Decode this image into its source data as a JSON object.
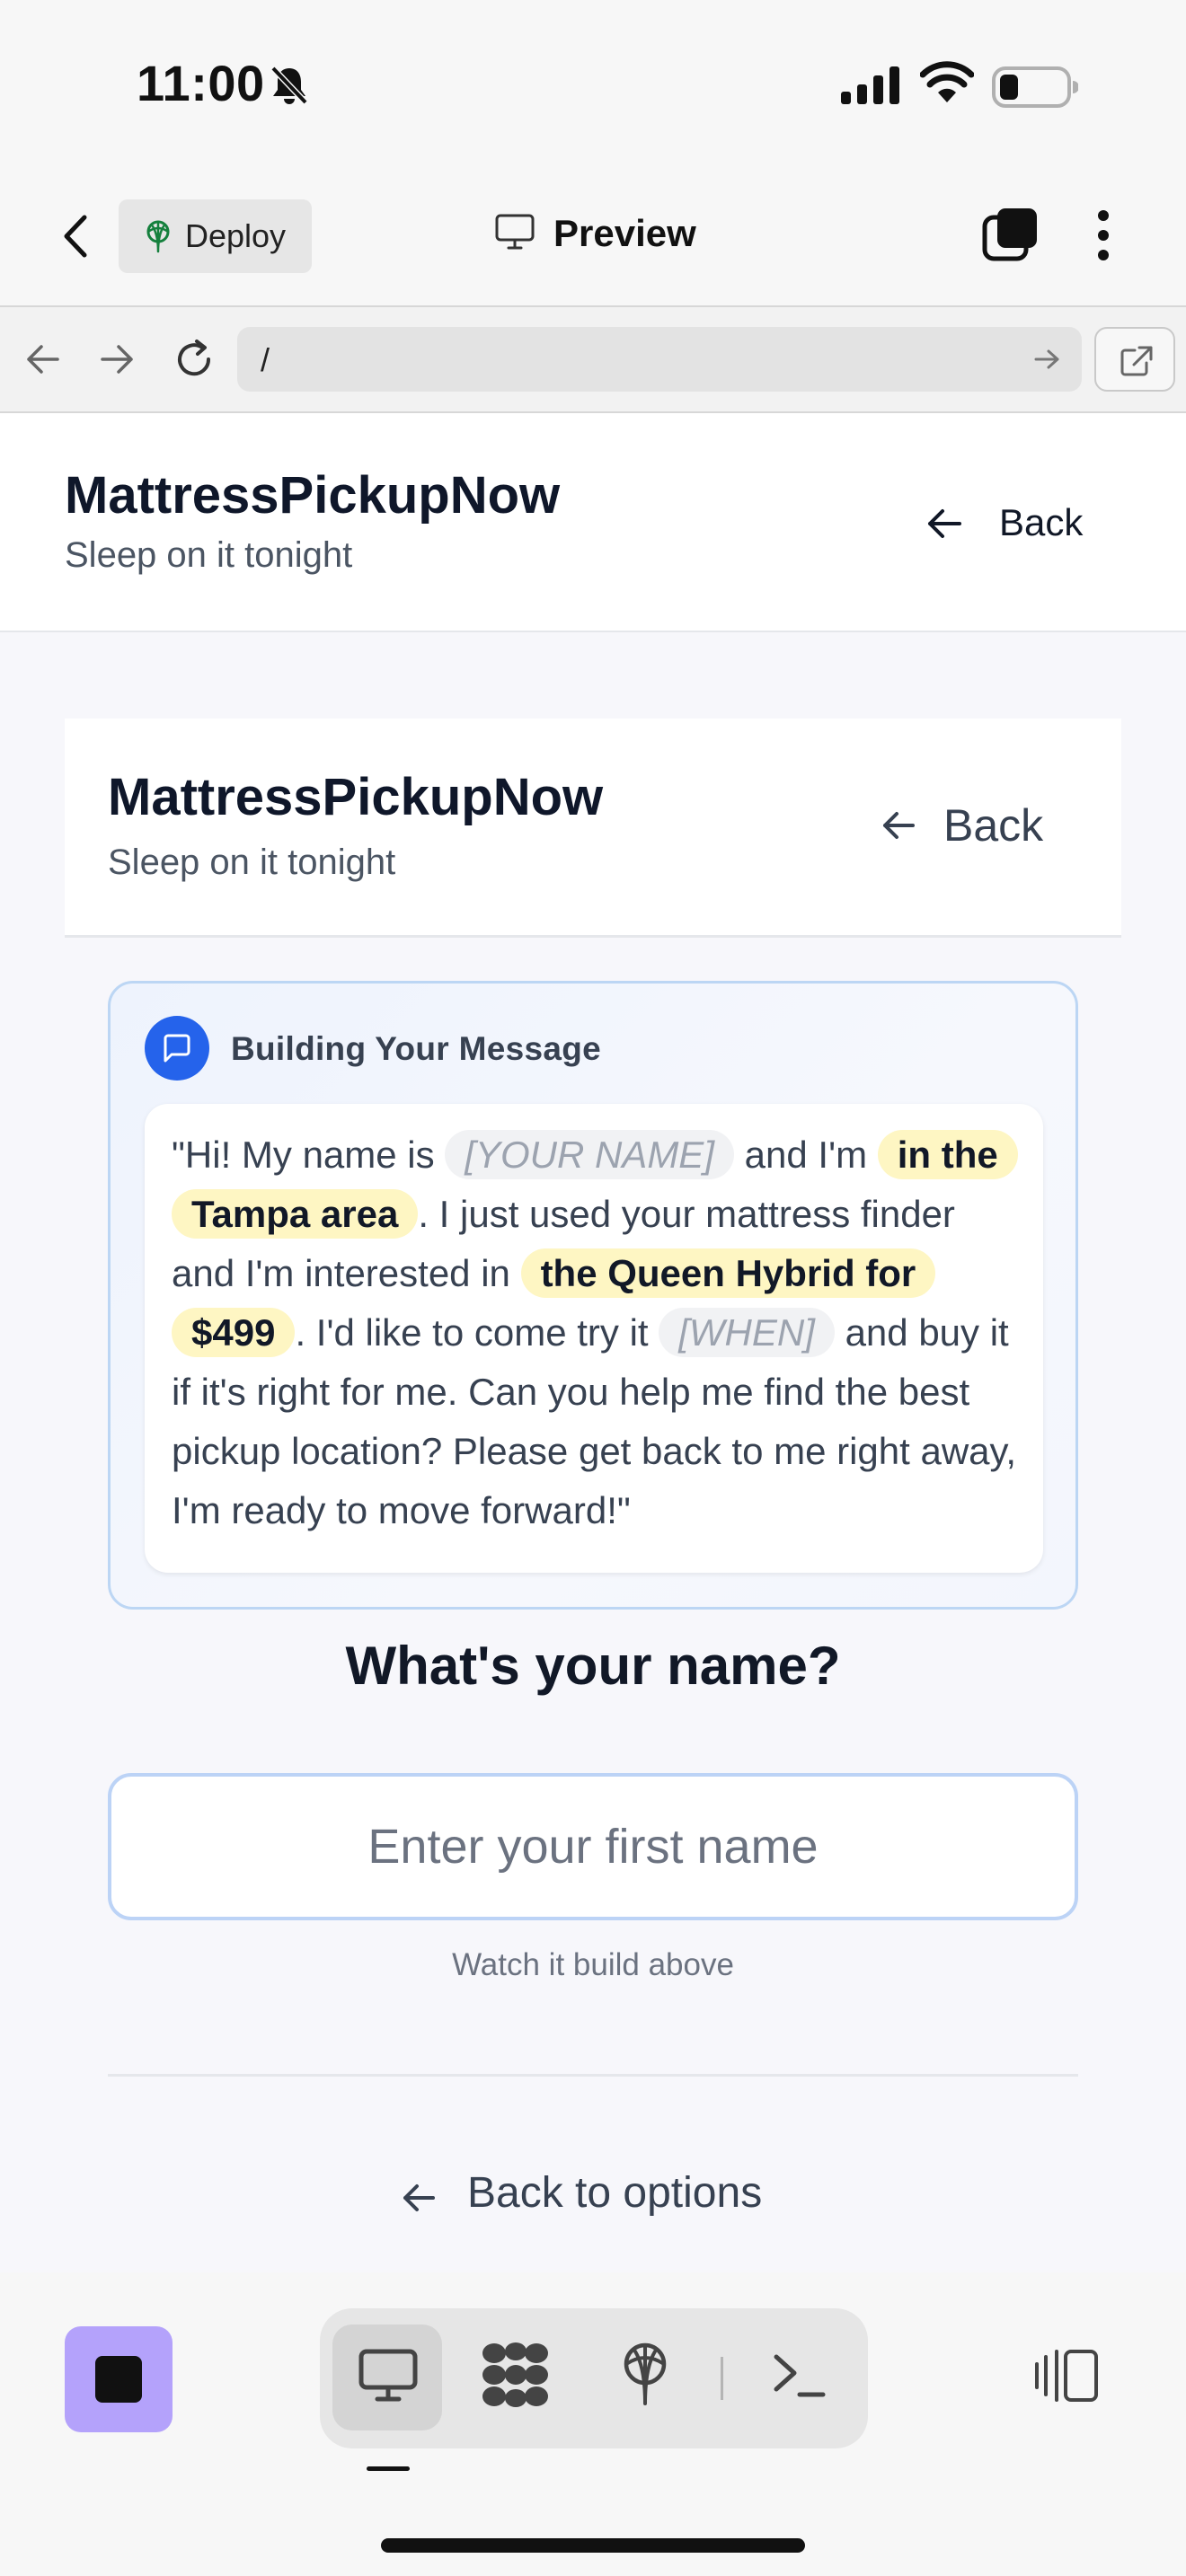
{
  "status_bar": {
    "time": "11:00",
    "icons": [
      "bell-slash-icon",
      "cellular-signal-icon",
      "wifi-icon",
      "battery-icon"
    ]
  },
  "top_bar": {
    "deploy_label": "Deploy",
    "preview_label": "Preview"
  },
  "browser": {
    "url": "/"
  },
  "app_header": {
    "title": "MattressPickupNow",
    "subtitle": "Sleep on it tonight",
    "back_label": "Back"
  },
  "inner_header": {
    "title": "MattressPickupNow",
    "subtitle": "Sleep on it tonight",
    "back_label": "Back"
  },
  "message_builder": {
    "header": "Building Your Message",
    "parts": {
      "p1": "\"Hi! My name is ",
      "name_placeholder": "[YOUR NAME]",
      "p2": " and I'm ",
      "area": "in the Tampa area",
      "p3": ". I just used your mattress finder and I'm interested in ",
      "product": "the Queen Hybrid for $499",
      "p4": ". I'd like to come try it ",
      "when_placeholder": "[WHEN]",
      "p5": " and buy it if it's right for me. Can you help me find the best pickup location? Please get back to me right away, I'm ready to move forward!\""
    }
  },
  "form": {
    "question": "What's your name?",
    "name_value": "",
    "name_placeholder": "Enter your first name",
    "hint": "Watch it build above",
    "back_to_options": "Back to options"
  },
  "colors": {
    "accent_blue": "#2563eb",
    "highlight_yellow": "#fef6c3",
    "stop_purple": "#b4a2fb"
  }
}
